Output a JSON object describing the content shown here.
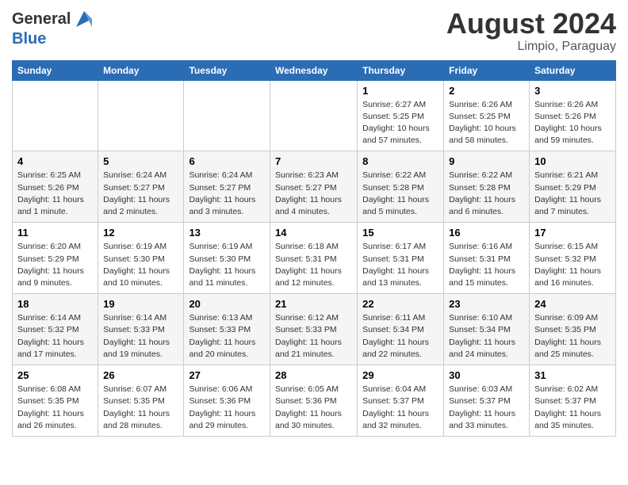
{
  "header": {
    "logo_general": "General",
    "logo_blue": "Blue",
    "month_year": "August 2024",
    "location": "Limpio, Paraguay"
  },
  "days_of_week": [
    "Sunday",
    "Monday",
    "Tuesday",
    "Wednesday",
    "Thursday",
    "Friday",
    "Saturday"
  ],
  "weeks": [
    [
      {
        "day": "",
        "info": ""
      },
      {
        "day": "",
        "info": ""
      },
      {
        "day": "",
        "info": ""
      },
      {
        "day": "",
        "info": ""
      },
      {
        "day": "1",
        "info": "Sunrise: 6:27 AM\nSunset: 5:25 PM\nDaylight: 10 hours and 57 minutes."
      },
      {
        "day": "2",
        "info": "Sunrise: 6:26 AM\nSunset: 5:25 PM\nDaylight: 10 hours and 58 minutes."
      },
      {
        "day": "3",
        "info": "Sunrise: 6:26 AM\nSunset: 5:26 PM\nDaylight: 10 hours and 59 minutes."
      }
    ],
    [
      {
        "day": "4",
        "info": "Sunrise: 6:25 AM\nSunset: 5:26 PM\nDaylight: 11 hours and 1 minute."
      },
      {
        "day": "5",
        "info": "Sunrise: 6:24 AM\nSunset: 5:27 PM\nDaylight: 11 hours and 2 minutes."
      },
      {
        "day": "6",
        "info": "Sunrise: 6:24 AM\nSunset: 5:27 PM\nDaylight: 11 hours and 3 minutes."
      },
      {
        "day": "7",
        "info": "Sunrise: 6:23 AM\nSunset: 5:27 PM\nDaylight: 11 hours and 4 minutes."
      },
      {
        "day": "8",
        "info": "Sunrise: 6:22 AM\nSunset: 5:28 PM\nDaylight: 11 hours and 5 minutes."
      },
      {
        "day": "9",
        "info": "Sunrise: 6:22 AM\nSunset: 5:28 PM\nDaylight: 11 hours and 6 minutes."
      },
      {
        "day": "10",
        "info": "Sunrise: 6:21 AM\nSunset: 5:29 PM\nDaylight: 11 hours and 7 minutes."
      }
    ],
    [
      {
        "day": "11",
        "info": "Sunrise: 6:20 AM\nSunset: 5:29 PM\nDaylight: 11 hours and 9 minutes."
      },
      {
        "day": "12",
        "info": "Sunrise: 6:19 AM\nSunset: 5:30 PM\nDaylight: 11 hours and 10 minutes."
      },
      {
        "day": "13",
        "info": "Sunrise: 6:19 AM\nSunset: 5:30 PM\nDaylight: 11 hours and 11 minutes."
      },
      {
        "day": "14",
        "info": "Sunrise: 6:18 AM\nSunset: 5:31 PM\nDaylight: 11 hours and 12 minutes."
      },
      {
        "day": "15",
        "info": "Sunrise: 6:17 AM\nSunset: 5:31 PM\nDaylight: 11 hours and 13 minutes."
      },
      {
        "day": "16",
        "info": "Sunrise: 6:16 AM\nSunset: 5:31 PM\nDaylight: 11 hours and 15 minutes."
      },
      {
        "day": "17",
        "info": "Sunrise: 6:15 AM\nSunset: 5:32 PM\nDaylight: 11 hours and 16 minutes."
      }
    ],
    [
      {
        "day": "18",
        "info": "Sunrise: 6:14 AM\nSunset: 5:32 PM\nDaylight: 11 hours and 17 minutes."
      },
      {
        "day": "19",
        "info": "Sunrise: 6:14 AM\nSunset: 5:33 PM\nDaylight: 11 hours and 19 minutes."
      },
      {
        "day": "20",
        "info": "Sunrise: 6:13 AM\nSunset: 5:33 PM\nDaylight: 11 hours and 20 minutes."
      },
      {
        "day": "21",
        "info": "Sunrise: 6:12 AM\nSunset: 5:33 PM\nDaylight: 11 hours and 21 minutes."
      },
      {
        "day": "22",
        "info": "Sunrise: 6:11 AM\nSunset: 5:34 PM\nDaylight: 11 hours and 22 minutes."
      },
      {
        "day": "23",
        "info": "Sunrise: 6:10 AM\nSunset: 5:34 PM\nDaylight: 11 hours and 24 minutes."
      },
      {
        "day": "24",
        "info": "Sunrise: 6:09 AM\nSunset: 5:35 PM\nDaylight: 11 hours and 25 minutes."
      }
    ],
    [
      {
        "day": "25",
        "info": "Sunrise: 6:08 AM\nSunset: 5:35 PM\nDaylight: 11 hours and 26 minutes."
      },
      {
        "day": "26",
        "info": "Sunrise: 6:07 AM\nSunset: 5:35 PM\nDaylight: 11 hours and 28 minutes."
      },
      {
        "day": "27",
        "info": "Sunrise: 6:06 AM\nSunset: 5:36 PM\nDaylight: 11 hours and 29 minutes."
      },
      {
        "day": "28",
        "info": "Sunrise: 6:05 AM\nSunset: 5:36 PM\nDaylight: 11 hours and 30 minutes."
      },
      {
        "day": "29",
        "info": "Sunrise: 6:04 AM\nSunset: 5:37 PM\nDaylight: 11 hours and 32 minutes."
      },
      {
        "day": "30",
        "info": "Sunrise: 6:03 AM\nSunset: 5:37 PM\nDaylight: 11 hours and 33 minutes."
      },
      {
        "day": "31",
        "info": "Sunrise: 6:02 AM\nSunset: 5:37 PM\nDaylight: 11 hours and 35 minutes."
      }
    ]
  ]
}
